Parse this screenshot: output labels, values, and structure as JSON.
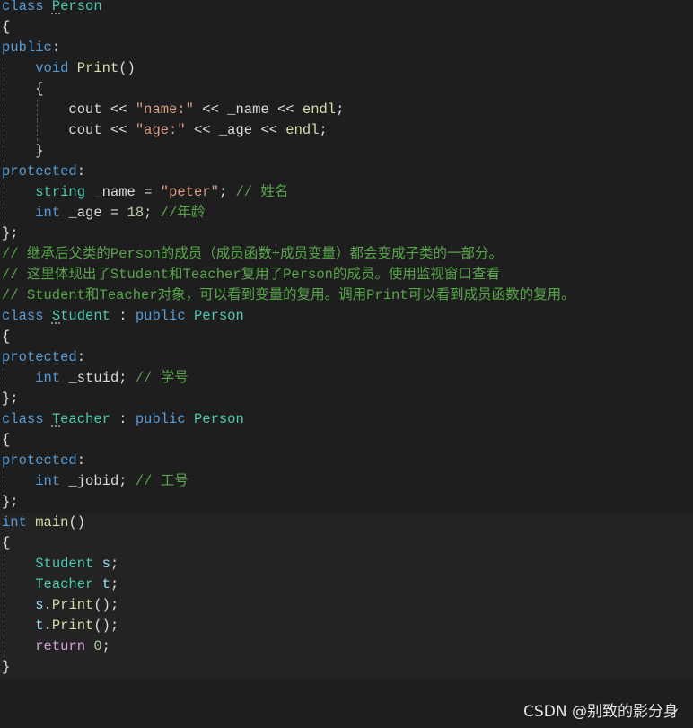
{
  "editor": {
    "colors": {
      "background": "#1e1e1e",
      "keyword": "#569cd6",
      "type": "#4ec9b0",
      "function": "#dcdcaa",
      "string": "#d69d85",
      "comment": "#57a64a",
      "variable": "#9cdcfe",
      "number": "#b5cea8",
      "control": "#d8a0df"
    },
    "lines": [
      {
        "g": 0,
        "t": [
          [
            "kw",
            "class "
          ],
          [
            "ty",
            "Person"
          ]
        ]
      },
      {
        "g": 0,
        "t": [
          [
            "pl",
            "{"
          ]
        ]
      },
      {
        "g": 0,
        "t": [
          [
            "kw",
            "public"
          ],
          [
            "pl",
            ":"
          ]
        ]
      },
      {
        "g": 1,
        "t": [
          [
            "pl",
            "    "
          ],
          [
            "kw",
            "void "
          ],
          [
            "fn",
            "Print"
          ],
          [
            "pl",
            "()"
          ]
        ]
      },
      {
        "g": 1,
        "t": [
          [
            "pl",
            "    {"
          ]
        ]
      },
      {
        "g": 2,
        "t": [
          [
            "pl",
            "        "
          ],
          [
            "pl",
            "cout << "
          ],
          [
            "st",
            "\"name:\""
          ],
          [
            "pl",
            " << _name << "
          ],
          [
            "fn",
            "endl"
          ],
          [
            "pl",
            ";"
          ]
        ]
      },
      {
        "g": 2,
        "t": [
          [
            "pl",
            "        "
          ],
          [
            "pl",
            "cout << "
          ],
          [
            "st",
            "\"age:\""
          ],
          [
            "pl",
            " << _age << "
          ],
          [
            "fn",
            "endl"
          ],
          [
            "pl",
            ";"
          ]
        ]
      },
      {
        "g": 1,
        "t": [
          [
            "pl",
            "    }"
          ]
        ]
      },
      {
        "g": 0,
        "t": [
          [
            "kw",
            "protected"
          ],
          [
            "pl",
            ":"
          ]
        ]
      },
      {
        "g": 1,
        "t": [
          [
            "pl",
            "    "
          ],
          [
            "ty",
            "string "
          ],
          [
            "pl",
            "_name = "
          ],
          [
            "st",
            "\"peter\""
          ],
          [
            "pl",
            "; "
          ],
          [
            "cm",
            "// 姓名"
          ]
        ]
      },
      {
        "g": 1,
        "t": [
          [
            "pl",
            "    "
          ],
          [
            "kw",
            "int "
          ],
          [
            "pl",
            "_age = "
          ],
          [
            "nu",
            "18"
          ],
          [
            "pl",
            "; "
          ],
          [
            "cm",
            "//年龄"
          ]
        ]
      },
      {
        "g": 0,
        "t": [
          [
            "pl",
            "};"
          ]
        ]
      },
      {
        "g": 0,
        "t": [
          [
            "cm",
            "// 继承后父类的Person的成员（成员函数+成员变量）都会变成子类的一部分。"
          ]
        ]
      },
      {
        "g": 0,
        "t": [
          [
            "cm",
            "// 这里体现出了Student和Teacher复用了Person的成员。使用监视窗口查看"
          ]
        ]
      },
      {
        "g": 0,
        "t": [
          [
            "cm",
            "// Student和Teacher对象，可以看到变量的复用。调用Print可以看到成员函数的复用。"
          ]
        ]
      },
      {
        "g": 0,
        "t": [
          [
            "kw",
            "class "
          ],
          [
            "ty",
            "Student"
          ],
          [
            "pl",
            " : "
          ],
          [
            "kw",
            "public "
          ],
          [
            "ty",
            "Person"
          ]
        ]
      },
      {
        "g": 0,
        "t": [
          [
            "pl",
            "{"
          ]
        ]
      },
      {
        "g": 0,
        "t": [
          [
            "kw",
            "protected"
          ],
          [
            "pl",
            ":"
          ]
        ]
      },
      {
        "g": 1,
        "t": [
          [
            "pl",
            "    "
          ],
          [
            "kw",
            "int "
          ],
          [
            "pl",
            "_stuid; "
          ],
          [
            "cm",
            "// 学号"
          ]
        ]
      },
      {
        "g": 0,
        "t": [
          [
            "pl",
            "};"
          ]
        ]
      },
      {
        "g": 0,
        "t": [
          [
            "kw",
            "class "
          ],
          [
            "ty",
            "Teacher"
          ],
          [
            "pl",
            " : "
          ],
          [
            "kw",
            "public "
          ],
          [
            "ty",
            "Person"
          ]
        ]
      },
      {
        "g": 0,
        "t": [
          [
            "pl",
            "{"
          ]
        ]
      },
      {
        "g": 0,
        "t": [
          [
            "kw",
            "protected"
          ],
          [
            "pl",
            ":"
          ]
        ]
      },
      {
        "g": 1,
        "t": [
          [
            "pl",
            "    "
          ],
          [
            "kw",
            "int "
          ],
          [
            "pl",
            "_jobid; "
          ],
          [
            "cm",
            "// 工号"
          ]
        ]
      },
      {
        "g": 0,
        "t": [
          [
            "pl",
            "};"
          ]
        ]
      },
      {
        "g": 0,
        "h": 1,
        "t": [
          [
            "kw",
            "int "
          ],
          [
            "fn",
            "main"
          ],
          [
            "pl",
            "()"
          ]
        ]
      },
      {
        "g": 0,
        "h": 1,
        "t": [
          [
            "pl",
            "{"
          ]
        ]
      },
      {
        "g": 1,
        "h": 1,
        "t": [
          [
            "pl",
            "    "
          ],
          [
            "ty",
            "Student "
          ],
          [
            "va",
            "s"
          ],
          [
            "pl",
            ";"
          ]
        ]
      },
      {
        "g": 1,
        "h": 1,
        "t": [
          [
            "pl",
            "    "
          ],
          [
            "ty",
            "Teacher "
          ],
          [
            "va",
            "t"
          ],
          [
            "pl",
            ";"
          ]
        ]
      },
      {
        "g": 1,
        "h": 1,
        "t": [
          [
            "pl",
            "    "
          ],
          [
            "va",
            "s"
          ],
          [
            "pl",
            "."
          ],
          [
            "fn",
            "Print"
          ],
          [
            "pl",
            "();"
          ]
        ]
      },
      {
        "g": 1,
        "h": 1,
        "t": [
          [
            "pl",
            "    "
          ],
          [
            "va",
            "t"
          ],
          [
            "pl",
            "."
          ],
          [
            "fn",
            "Print"
          ],
          [
            "pl",
            "();"
          ]
        ]
      },
      {
        "g": 1,
        "h": 1,
        "t": [
          [
            "pl",
            "    "
          ],
          [
            "ct",
            "return "
          ],
          [
            "nu",
            "0"
          ],
          [
            "pl",
            ";"
          ]
        ]
      },
      {
        "g": 0,
        "h": 1,
        "t": [
          [
            "pl",
            "}"
          ]
        ]
      }
    ]
  },
  "watermark": "CSDN @别致的影分身"
}
